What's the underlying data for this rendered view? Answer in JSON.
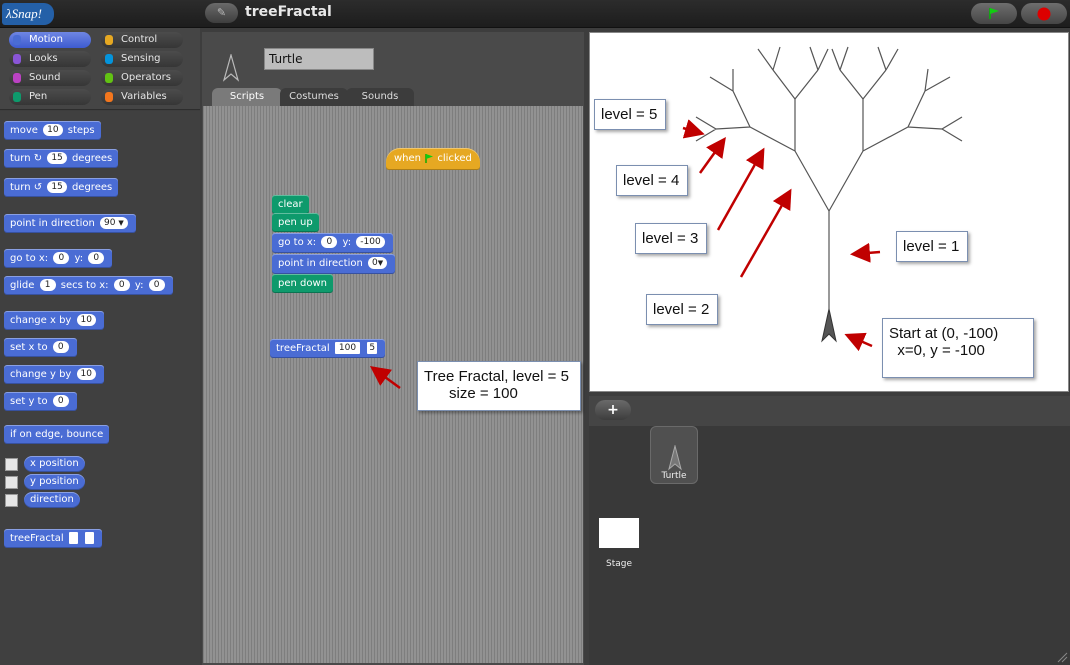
{
  "app": {
    "logo": "λSnap!",
    "project_title": "treeFractal"
  },
  "categories": [
    {
      "label": "Motion",
      "color": "#4a6cd4"
    },
    {
      "label": "Looks",
      "color": "#8a55d7"
    },
    {
      "label": "Sound",
      "color": "#bb42c3"
    },
    {
      "label": "Pen",
      "color": "#0e9a6c"
    },
    {
      "label": "Control",
      "color": "#e6a822"
    },
    {
      "label": "Sensing",
      "color": "#0494dc"
    },
    {
      "label": "Operators",
      "color": "#62c213"
    },
    {
      "label": "Variables",
      "color": "#f3761d"
    }
  ],
  "palette": {
    "move": {
      "a": "move",
      "v": "10",
      "b": "steps"
    },
    "turn_cw": {
      "a": "turn",
      "icon": "↻",
      "v": "15",
      "b": "degrees"
    },
    "turn_ccw": {
      "a": "turn",
      "icon": "↺",
      "v": "15",
      "b": "degrees"
    },
    "point_dir": {
      "a": "point in direction",
      "v": "90"
    },
    "goto": {
      "a": "go to x:",
      "x": "0",
      "b": "y:",
      "y": "0"
    },
    "glide": {
      "a": "glide",
      "v": "1",
      "b": "secs to x:",
      "x": "0",
      "c": "y:",
      "y": "0"
    },
    "change_x": {
      "a": "change x by",
      "v": "10"
    },
    "set_x": {
      "a": "set x to",
      "v": "0"
    },
    "change_y": {
      "a": "change y by",
      "v": "10"
    },
    "set_y": {
      "a": "set y to",
      "v": "0"
    },
    "edge": {
      "a": "if on edge, bounce"
    },
    "reporters": [
      "x position",
      "y position",
      "direction"
    ],
    "custom": {
      "a": "treeFractal"
    }
  },
  "sprite": {
    "name": "Turtle"
  },
  "tabs": [
    "Scripts",
    "Costumes",
    "Sounds"
  ],
  "scripts": {
    "hat": {
      "a": "when",
      "b": "clicked"
    },
    "clear": "clear",
    "pen_up": "pen up",
    "goto": {
      "a": "go to x:",
      "x": "0",
      "b": "y:",
      "y": "-100"
    },
    "point_dir": {
      "a": "point in direction",
      "v": "0"
    },
    "pen_down": "pen down",
    "tree": {
      "a": "treeFractal",
      "size": "100",
      "level": "5"
    }
  },
  "callouts": {
    "tree_call": [
      "Tree Fractal, level = 5",
      "      size = 100"
    ],
    "level5": "level = 5",
    "level4": "level = 4",
    "level3": "level = 3",
    "level2": "level = 2",
    "level1": "level = 1",
    "start": [
      "Start at (0, -100)",
      "  x=0, y = -100"
    ]
  },
  "corral": {
    "sprite_label": "Turtle",
    "stage_label": "Stage",
    "add_label": "+"
  },
  "colors": {
    "motion": "#4a6cd4",
    "pen": "#0e9a6c",
    "control": "#e6a822",
    "arrow": "#c00000",
    "tree": "#555555"
  }
}
